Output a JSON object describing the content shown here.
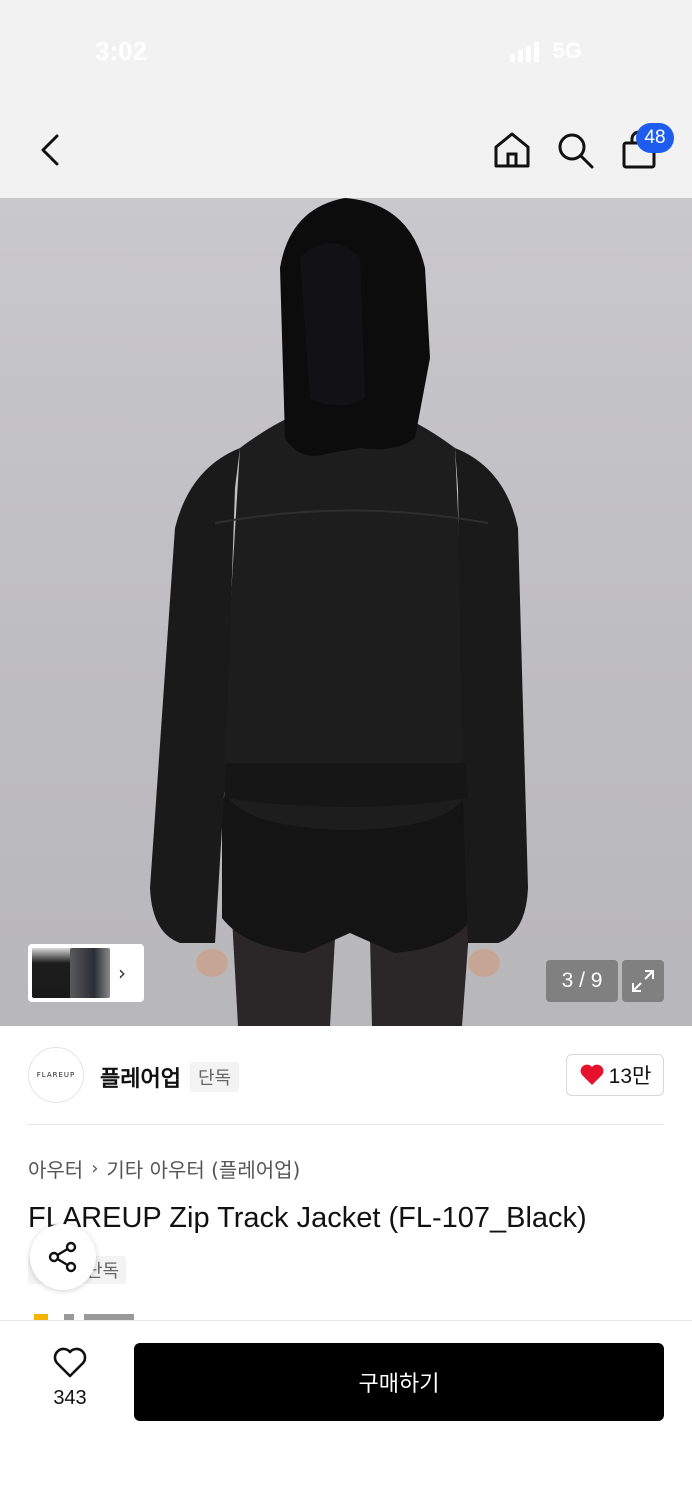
{
  "status_bar": {
    "time": "3:02",
    "network": "5G"
  },
  "header": {
    "cart_count": "48"
  },
  "gallery": {
    "counter": "3 / 9"
  },
  "brand": {
    "logo_text": "FLAREUP",
    "name": "플레어업",
    "tag": "단독",
    "likes": "13만"
  },
  "breadcrumb": {
    "category": "아우터",
    "subcategory": "기타 아우터 (플레어업)"
  },
  "product": {
    "title": "FLAREUP Zip Track Jacket (FL-107_Black)",
    "tag": "단독"
  },
  "bottom_bar": {
    "wish_count": "343",
    "buy_label": "구매하기"
  },
  "colors": {
    "accent": "#1e5cf0",
    "heart": "#e8112d",
    "buy_button": "#000000"
  }
}
